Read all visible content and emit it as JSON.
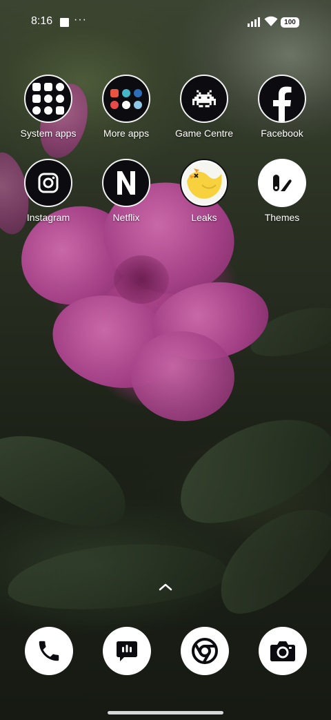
{
  "status_bar": {
    "time": "8:16",
    "battery": "100",
    "icons": [
      "notification-square-icon",
      "more-dots-icon",
      "signal-icon",
      "wifi-icon",
      "battery-icon"
    ],
    "more_indicator": "···"
  },
  "apps": [
    {
      "label": "System apps",
      "icon": "folder-icon",
      "style": "dark"
    },
    {
      "label": "More apps",
      "icon": "folder-icon",
      "style": "dark"
    },
    {
      "label": "Game Centre",
      "icon": "space-invader-icon",
      "style": "dark"
    },
    {
      "label": "Facebook",
      "icon": "facebook-f-icon",
      "style": "dark"
    },
    {
      "label": "Instagram",
      "icon": "instagram-camera-icon",
      "style": "dark"
    },
    {
      "label": "Netflix",
      "icon": "netflix-n-icon",
      "style": "dark"
    },
    {
      "label": "Leaks",
      "icon": "yellow-bird-icon",
      "style": "light"
    },
    {
      "label": "Themes",
      "icon": "themes-icon",
      "style": "light"
    }
  ],
  "dock": [
    {
      "name": "phone",
      "icon": "phone-icon"
    },
    {
      "name": "messages",
      "icon": "message-icon"
    },
    {
      "name": "chrome",
      "icon": "chrome-icon"
    },
    {
      "name": "camera",
      "icon": "camera-icon"
    }
  ],
  "colors": {
    "flower": "#a8418a",
    "icon_dark": "#0c0c10",
    "leaks_yellow": "#f7d23e"
  }
}
